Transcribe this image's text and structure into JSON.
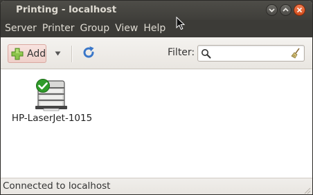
{
  "window": {
    "title": "Printing - localhost"
  },
  "titlebar_buttons": [
    {
      "name": "minimize",
      "icon": "minimize-icon"
    },
    {
      "name": "maximize",
      "icon": "maximize-icon"
    },
    {
      "name": "close",
      "icon": "close-icon"
    }
  ],
  "menubar": {
    "items": [
      {
        "label": "Server"
      },
      {
        "label": "Printer"
      },
      {
        "label": "Group"
      },
      {
        "label": "View"
      },
      {
        "label": "Help"
      }
    ]
  },
  "toolbar": {
    "add_label": "Add",
    "add_icon": "plus-icon",
    "dropdown_icon": "dropdown-arrow-icon",
    "refresh_icon": "refresh-icon",
    "filter_label": "Filter:",
    "filter_value": "",
    "search_icon": "search-icon",
    "clear_icon": "clear-broom-icon"
  },
  "printers": [
    {
      "name": "HP-LaserJet-1015",
      "status_icon": "checkmark-icon",
      "is_default": true
    }
  ],
  "statusbar": {
    "text": "Connected to localhost"
  },
  "colors": {
    "titlebar": "#3c3b37",
    "title_text": "#dfdbd2",
    "close_button": "#e0612e",
    "add_button_bg": "#f3d8d2",
    "default_check": "#2f9b2a",
    "refresh_blue": "#3a77c9"
  }
}
